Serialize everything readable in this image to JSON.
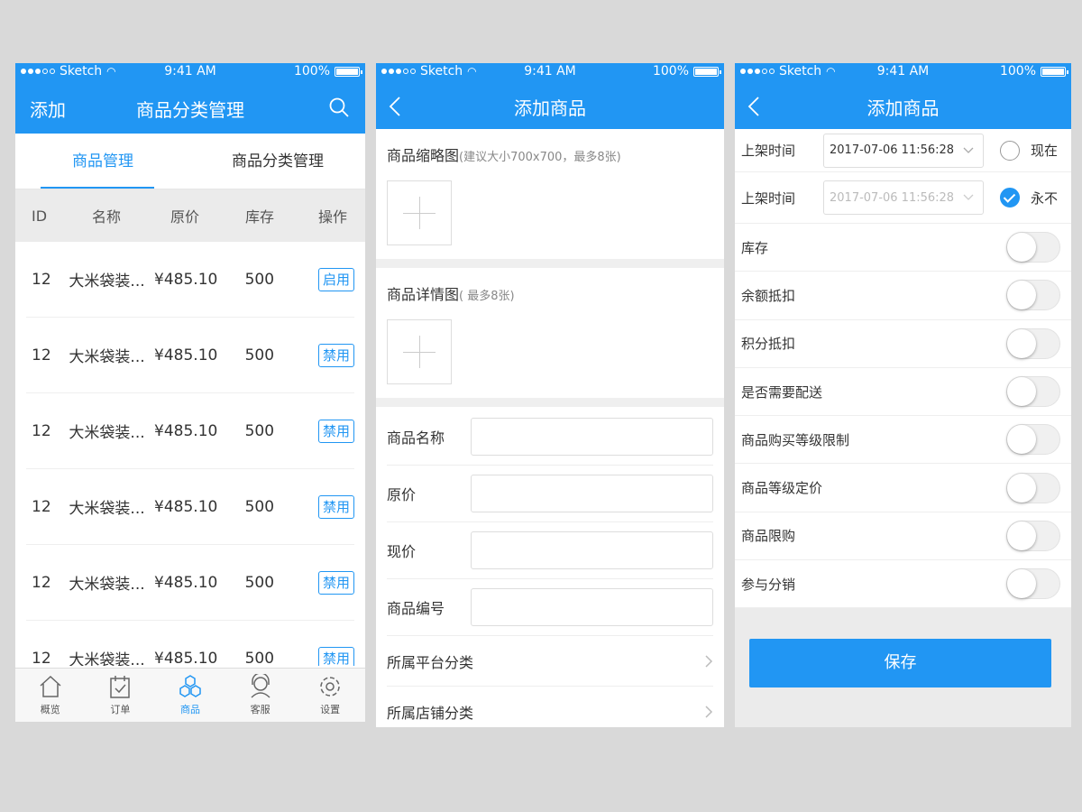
{
  "status": {
    "carrier": "Sketch",
    "time": "9:41 AM",
    "battery": "100%"
  },
  "panel1": {
    "nav_left": "添加",
    "title": "商品分类管理",
    "tabs": [
      "商品管理",
      "商品分类管理"
    ],
    "columns": [
      "ID",
      "名称",
      "原价",
      "库存",
      "操作"
    ],
    "rows": [
      {
        "id": "12",
        "name": "大米袋装...",
        "price": "¥485.10",
        "stock": "500",
        "op": "启用"
      },
      {
        "id": "12",
        "name": "大米袋装...",
        "price": "¥485.10",
        "stock": "500",
        "op": "禁用"
      },
      {
        "id": "12",
        "name": "大米袋装...",
        "price": "¥485.10",
        "stock": "500",
        "op": "禁用"
      },
      {
        "id": "12",
        "name": "大米袋装...",
        "price": "¥485.10",
        "stock": "500",
        "op": "禁用"
      },
      {
        "id": "12",
        "name": "大米袋装...",
        "price": "¥485.10",
        "stock": "500",
        "op": "禁用"
      },
      {
        "id": "12",
        "name": "大米袋装...",
        "price": "¥485.10",
        "stock": "500",
        "op": "禁用"
      }
    ],
    "tabbar": [
      {
        "label": "概览",
        "icon": "home-icon"
      },
      {
        "label": "订单",
        "icon": "order-icon"
      },
      {
        "label": "商品",
        "icon": "goods-icon"
      },
      {
        "label": "客服",
        "icon": "service-icon"
      },
      {
        "label": "设置",
        "icon": "settings-icon"
      }
    ],
    "active_tab": "商品"
  },
  "panel2": {
    "title": "添加商品",
    "thumb_label": "商品缩略图",
    "thumb_hint": "(建议大小700x700，最多8张)",
    "detail_label": "商品详情图",
    "detail_hint": "( 最多8张)",
    "fields": [
      "商品名称",
      "原价",
      "现价",
      "商品编号"
    ],
    "links": [
      "所属平台分类",
      "所属店铺分类"
    ]
  },
  "panel3": {
    "title": "添加商品",
    "date_rows": [
      {
        "label": "上架时间",
        "value": "2017-07-06 11:56:28",
        "option": "现在",
        "checked": false
      },
      {
        "label": "上架时间",
        "value": "2017-07-06 11:56:28",
        "option": "永不",
        "checked": true
      }
    ],
    "toggles": [
      "库存",
      "余额抵扣",
      "积分抵扣",
      "是否需要配送",
      "商品购买等级限制",
      "商品等级定价",
      "商品限购",
      "参与分销"
    ],
    "save": "保存"
  },
  "colors": {
    "primary": "#2196f3",
    "page_bg": "#d9d9d9"
  }
}
